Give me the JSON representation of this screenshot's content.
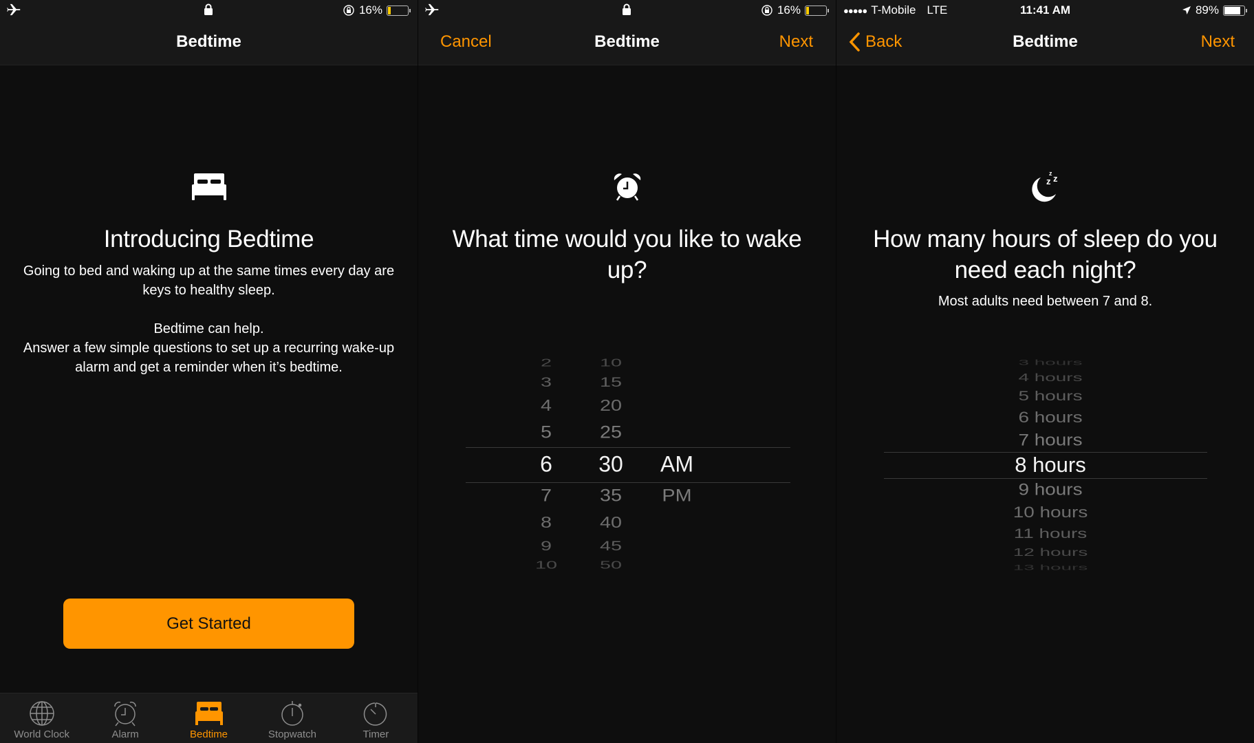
{
  "colors": {
    "accent": "#ff9500",
    "background": "#0e0e0e",
    "bar": "#181818"
  },
  "panels": [
    {
      "status": {
        "left_icon": "airplane-icon",
        "center_icon": "lock-icon",
        "rotation_lock_icon": "rotation-lock-icon",
        "battery_percent": "16%",
        "battery_level": 0.16,
        "battery_color": "#ffcc00"
      },
      "nav": {
        "title": "Bedtime"
      },
      "icon": "bed-icon",
      "title": "Introducing Bedtime",
      "paragraphs": [
        "Going to bed and waking up at the same times every day are",
        "keys to healthy sleep.",
        "Bedtime can help.",
        "Answer a few simple questions to set up a recurring wake-up",
        "alarm and get a reminder when it’s bedtime."
      ],
      "cta_label": "Get Started",
      "tabs": [
        {
          "label": "World Clock",
          "icon": "globe-icon",
          "active": false
        },
        {
          "label": "Alarm",
          "icon": "alarm-clock-icon",
          "active": false
        },
        {
          "label": "Bedtime",
          "icon": "bed-icon",
          "active": true
        },
        {
          "label": "Stopwatch",
          "icon": "stopwatch-icon",
          "active": false
        },
        {
          "label": "Timer",
          "icon": "timer-icon",
          "active": false
        }
      ]
    },
    {
      "status": {
        "left_icon": "airplane-icon",
        "center_icon": "lock-icon",
        "rotation_lock_icon": "rotation-lock-icon",
        "battery_percent": "16%",
        "battery_level": 0.16,
        "battery_color": "#ffcc00"
      },
      "nav": {
        "title": "Bedtime",
        "left_label": "Cancel",
        "right_label": "Next"
      },
      "icon": "alarm-clock-icon",
      "title_lines": [
        "What time would you like to wake",
        "up?"
      ],
      "picker": {
        "hours": [
          "2",
          "3",
          "4",
          "5",
          "6",
          "7",
          "8",
          "9",
          "10"
        ],
        "minutes": [
          "10",
          "15",
          "20",
          "25",
          "30",
          "35",
          "40",
          "45",
          "50"
        ],
        "period": [
          "AM",
          "PM"
        ],
        "selected": {
          "hour": "6",
          "minute": "30",
          "period": "AM"
        }
      }
    },
    {
      "status": {
        "signal_dots": "●●●●●",
        "carrier": "T-Mobile",
        "network": "LTE",
        "time": "11:41 AM",
        "location_icon": "location-arrow-icon",
        "battery_percent": "89%",
        "battery_level": 0.89,
        "battery_color": "#ffffff"
      },
      "nav": {
        "title": "Bedtime",
        "left_label": "Back",
        "right_label": "Next"
      },
      "icon": "moon-zzz-icon",
      "title_lines": [
        "How many hours of sleep do you",
        "need each night?"
      ],
      "subtitle": "Most adults need between 7 and 8.",
      "picker": {
        "options": [
          "3 hours",
          "4 hours",
          "5 hours",
          "6 hours",
          "7 hours",
          "8 hours",
          "9 hours",
          "10 hours",
          "11 hours",
          "12 hours",
          "13 hours"
        ],
        "selected": "8 hours"
      }
    }
  ]
}
